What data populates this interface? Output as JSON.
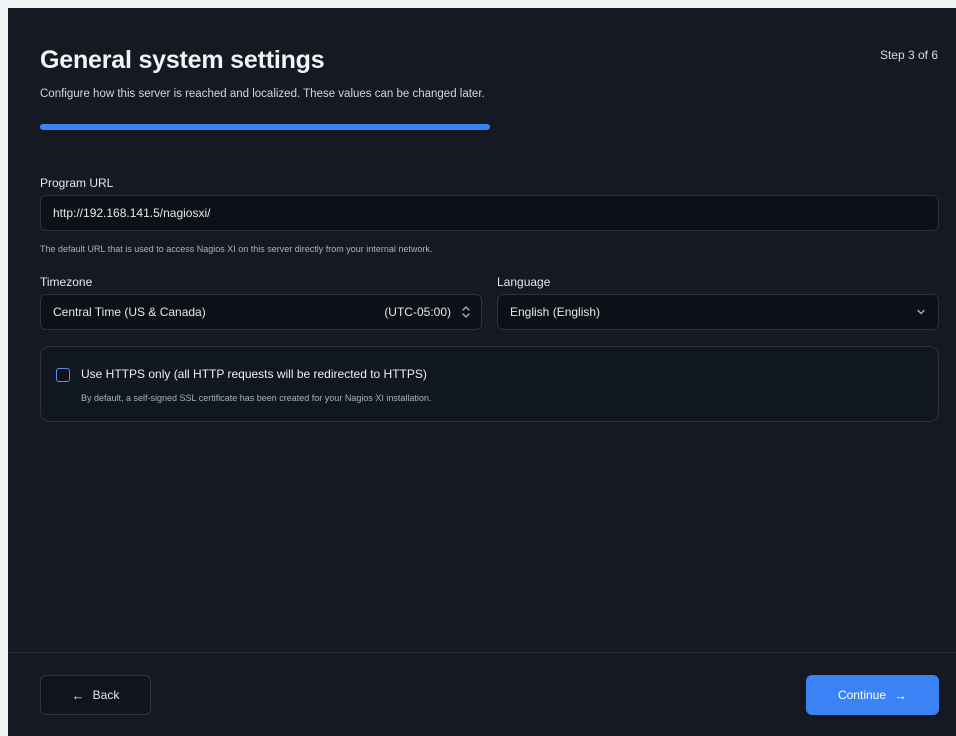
{
  "header": {
    "title": "General system settings",
    "step": "Step 3 of 6",
    "subtitle": "Configure how this server is reached and localized. These values can be changed later."
  },
  "progress": {
    "fraction": 0.5
  },
  "program_url": {
    "label": "Program URL",
    "value": "http://192.168.141.5/nagiosxi/",
    "help": "The default URL that is used to access Nagios XI on this server directly from your internal network."
  },
  "timezone": {
    "label": "Timezone",
    "value": "Central Time (US & Canada)",
    "offset": "(UTC-05:00)"
  },
  "language": {
    "label": "Language",
    "value": "English (English)"
  },
  "https": {
    "label": "Use HTTPS only (all HTTP requests will be redirected to HTTPS)",
    "help": "By default, a self-signed SSL certificate has been created for your Nagios XI installation.",
    "checked": false
  },
  "footer": {
    "back_label": "Back",
    "back_icon": "←",
    "continue_label": "Continue",
    "continue_icon": "→"
  },
  "colors": {
    "accent": "#3b82f6",
    "background": "#141922"
  }
}
